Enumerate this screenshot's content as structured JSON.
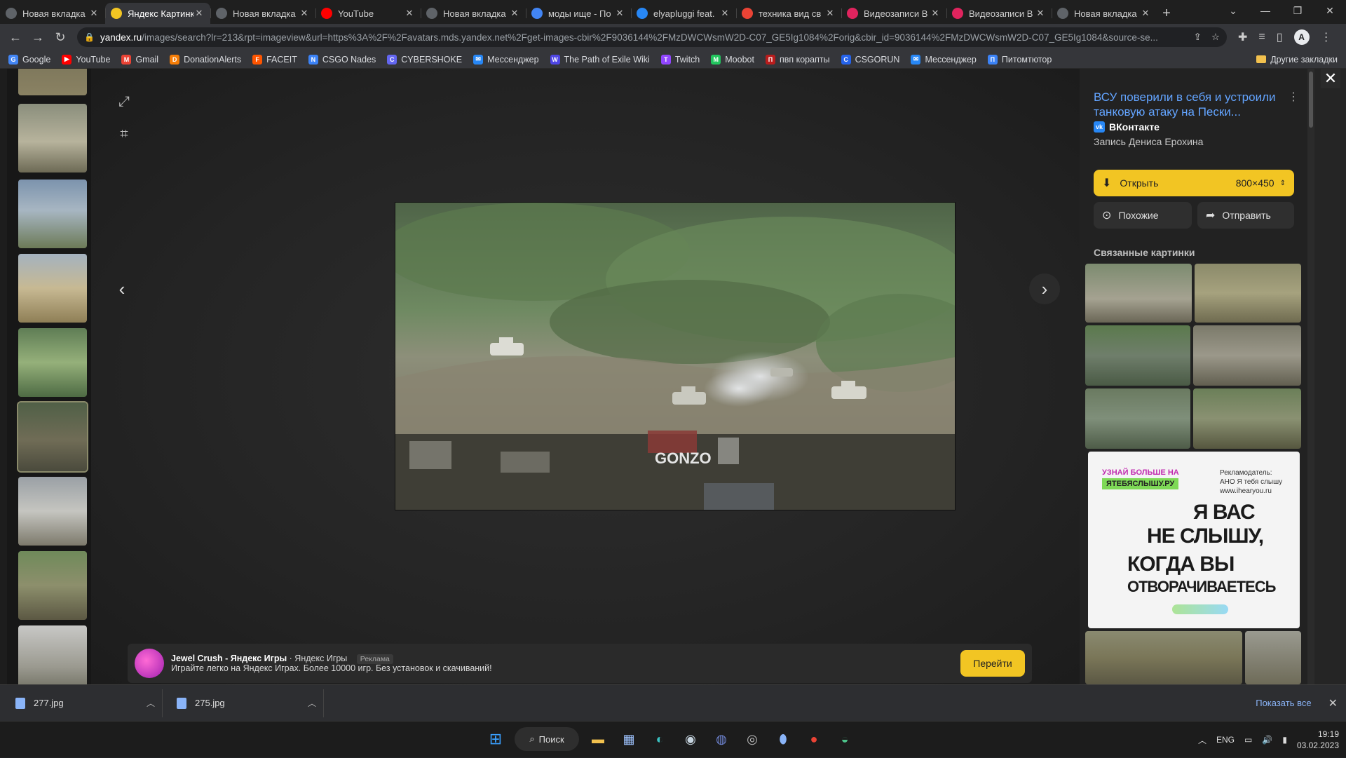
{
  "browser": {
    "tabs": [
      {
        "title": "Новая вкладка",
        "icon": "globe-icon",
        "color": "#5f6368",
        "active": false
      },
      {
        "title": "Яндекс Картинки",
        "icon": "yandex-images-icon",
        "color": "#f2c523",
        "active": true
      },
      {
        "title": "Новая вкладка",
        "icon": "globe-icon",
        "color": "#5f6368",
        "active": false
      },
      {
        "title": "YouTube",
        "icon": "youtube-icon",
        "color": "#ff0000",
        "active": false
      },
      {
        "title": "Новая вкладка",
        "icon": "globe-icon",
        "color": "#5f6368",
        "active": false
      },
      {
        "title": "моды ище - По",
        "icon": "google-icon",
        "color": "#4285f4",
        "active": false
      },
      {
        "title": "elyapluggi feat.",
        "icon": "vk-icon",
        "color": "#2787f5",
        "active": false
      },
      {
        "title": "техника вид св",
        "icon": "gmail-icon",
        "color": "#ea4335",
        "active": false
      },
      {
        "title": "Видеозаписи В",
        "icon": "video-icon",
        "color": "#e0245e",
        "active": false
      },
      {
        "title": "Видеозаписи В",
        "icon": "video-icon",
        "color": "#e0245e",
        "active": false
      },
      {
        "title": "Новая вкладка",
        "icon": "globe-icon",
        "color": "#5f6368",
        "active": false
      }
    ],
    "url_host": "yandex.ru",
    "url_rest": "/images/search?lr=213&rpt=imageview&url=https%3A%2F%2Favatars.mds.yandex.net%2Fget-images-cbir%2F9036144%2FMzDWCWsmW2D-C07_GE5Ig1084%2Forig&cbir_id=9036144%2FMzDWCWsmW2D-C07_GE5Ig1084&source-se...",
    "bookmarks": [
      {
        "label": "Google",
        "color": "#4285f4",
        "glyph": "G"
      },
      {
        "label": "YouTube",
        "color": "#ff0000",
        "glyph": "▶"
      },
      {
        "label": "Gmail",
        "color": "#ea4335",
        "glyph": "M"
      },
      {
        "label": "DonationAlerts",
        "color": "#f57d07",
        "glyph": "D"
      },
      {
        "label": "FACEIT",
        "color": "#ff5500",
        "glyph": "F"
      },
      {
        "label": "CSGO Nades",
        "color": "#3b82f6",
        "glyph": "N"
      },
      {
        "label": "CYBERSHOKE",
        "color": "#6366f1",
        "glyph": "C"
      },
      {
        "label": "Мессенджер",
        "color": "#2787f5",
        "glyph": "✉"
      },
      {
        "label": "The Path of Exile Wiki",
        "color": "#4f46e5",
        "glyph": "W"
      },
      {
        "label": "Twitch",
        "color": "#9146ff",
        "glyph": "T"
      },
      {
        "label": "Moobot",
        "color": "#22c55e",
        "glyph": "M"
      },
      {
        "label": "пвп корапты",
        "color": "#b91c1c",
        "glyph": "П"
      },
      {
        "label": "CSGORUN",
        "color": "#2563eb",
        "glyph": "C"
      },
      {
        "label": "Мессенджер",
        "color": "#2787f5",
        "glyph": "✉"
      },
      {
        "label": "Питомтютор",
        "color": "#3b82f6",
        "glyph": "П"
      }
    ],
    "bookmarks_other": "Другие закладки"
  },
  "viewer": {
    "panel": {
      "title": "ВСУ поверили в себя и устроили танковую атаку на Пески...",
      "source": "ВКонтакте",
      "author": "Запись Дениса Ерохина",
      "open_label": "Открыть",
      "size_label": "800×450",
      "similar_label": "Похожие",
      "share_label": "Отправить",
      "related_heading": "Связанные картинки"
    },
    "ad_card": {
      "promo": "УЗНАЙ БОЛЬШЕ НА",
      "promo_url": "ЯТЕБЯСЛЫШУ.РУ",
      "advertiser": "Рекламодатель: АНО Я тебя слышу www.ihearyou.ru",
      "line1": "Я ВАС",
      "line2": "НЕ СЛЫШУ,",
      "line3": "КОГДА ВЫ",
      "line4": "ОТВОРАЧИВАЕТЕСЬ"
    },
    "image_watermark": "GONZO",
    "ad_banner": {
      "title": "Jewel Crush - Яндекс Игры",
      "source": "· Яндекс Игры",
      "mark": "Реклама",
      "text": "Играйте легко на Яндекс Играх. Более 10000 игр. Без установок и скачиваний!",
      "button": "Перейти"
    }
  },
  "downloads": {
    "items": [
      "277.jpg",
      "275.jpg"
    ],
    "show_all": "Показать все"
  },
  "taskbar": {
    "search_label": "Поиск",
    "lang": "ENG",
    "time": "19:19",
    "date": "03.02.2023"
  }
}
